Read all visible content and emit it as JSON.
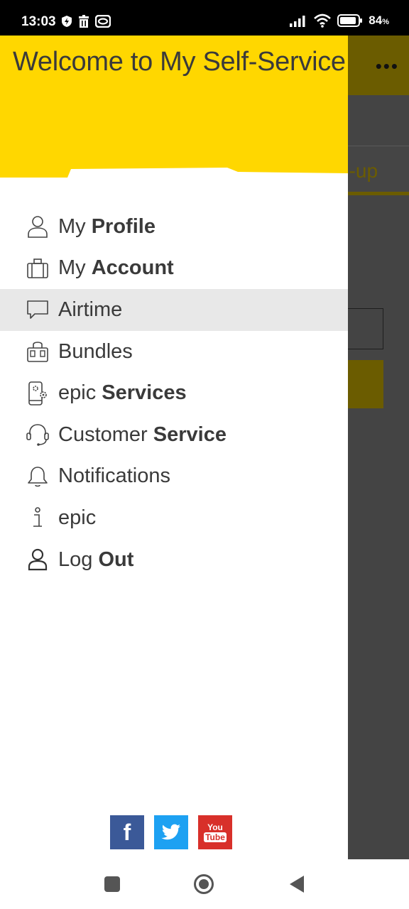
{
  "status_bar": {
    "time": "13:03",
    "battery_percent": "84",
    "battery_unit": "%"
  },
  "background_app": {
    "tab_partial_text": "p-up"
  },
  "drawer": {
    "title": "Welcome to My Self-Service",
    "menu": [
      {
        "light": "My ",
        "bold": "Profile",
        "icon": "user-outline-icon"
      },
      {
        "light": "My ",
        "bold": "Account",
        "icon": "briefcase-icon"
      },
      {
        "light": "Airtime",
        "bold": "",
        "icon": "chat-bubble-icon"
      },
      {
        "light": "Bundles",
        "bold": "",
        "icon": "shopping-bag-icon"
      },
      {
        "light": "epic ",
        "bold": "Services",
        "icon": "phone-gear-icon"
      },
      {
        "light": "Customer ",
        "bold": "Service",
        "icon": "headset-icon"
      },
      {
        "light": "Notifications",
        "bold": "",
        "icon": "bell-icon"
      },
      {
        "light": "epic",
        "bold": "",
        "icon": "info-icon"
      },
      {
        "light": "Log ",
        "bold": "Out",
        "icon": "user-logout-icon"
      }
    ],
    "active_index": 2,
    "social": {
      "facebook": "f",
      "youtube_top": "You",
      "youtube_bottom": "Tube"
    }
  },
  "colors": {
    "brand_yellow": "#ffd700",
    "active_row": "#e8e8e8",
    "facebook": "#3b5998",
    "twitter": "#1da1f2",
    "youtube": "#d8302a"
  }
}
